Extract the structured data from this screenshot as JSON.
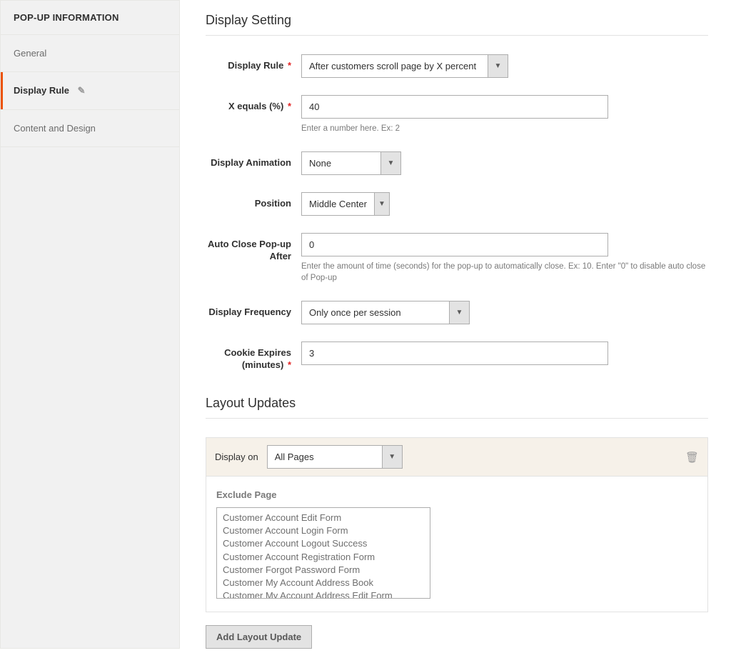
{
  "sidebar": {
    "header": "POP-UP INFORMATION",
    "items": [
      {
        "label": "General"
      },
      {
        "label": "Display Rule"
      },
      {
        "label": "Content and Design"
      }
    ]
  },
  "displaySetting": {
    "title": "Display Setting",
    "fields": {
      "displayRule": {
        "label": "Display Rule",
        "value": "After customers scroll page by X percent"
      },
      "xEquals": {
        "label": "X equals (%)",
        "value": "40",
        "note": "Enter a number here. Ex: 2"
      },
      "animation": {
        "label": "Display Animation",
        "value": "None"
      },
      "position": {
        "label": "Position",
        "value": "Middle Center"
      },
      "autoClose": {
        "label": "Auto Close Pop-up After",
        "value": "0",
        "note": "Enter the amount of time (seconds) for the pop-up to automatically close. Ex: 10. Enter \"0\" to disable auto close of Pop-up"
      },
      "frequency": {
        "label": "Display Frequency",
        "value": "Only once per session"
      },
      "cookie": {
        "label": "Cookie Expires (minutes)",
        "value": "3"
      }
    }
  },
  "layoutUpdates": {
    "title": "Layout Updates",
    "displayOnLabel": "Display on",
    "displayOnValue": "All Pages",
    "excludeLabel": "Exclude Page",
    "options": [
      "Customer Account Edit Form",
      "Customer Account Login Form",
      "Customer Account Logout Success",
      "Customer Account Registration Form",
      "Customer Forgot Password Form",
      "Customer My Account Address Book",
      "Customer My Account Address Edit Form"
    ],
    "addButton": "Add Layout Update"
  }
}
